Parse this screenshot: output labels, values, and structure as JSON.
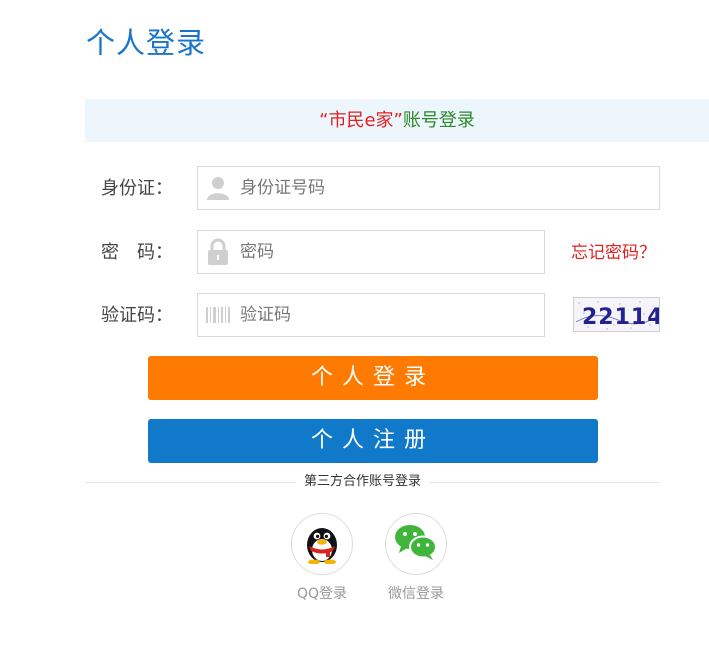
{
  "header": {
    "title": "个人登录"
  },
  "banner": {
    "brand": "“市民e家”",
    "suffix": "账号登录"
  },
  "form": {
    "id_label": "身份证：",
    "id_placeholder": "身份证号码",
    "password_label": "密　码：",
    "password_placeholder": "密码",
    "forgot_label": "忘记密码？",
    "captcha_label": "验证码：",
    "captcha_placeholder": "验证码",
    "captcha_text": "22114"
  },
  "actions": {
    "login_label": "个人登录",
    "register_label": "个人注册"
  },
  "third_party": {
    "title": "第三方合作账号登录",
    "qq_label": "QQ登录",
    "wechat_label": "微信登录"
  },
  "colors": {
    "title": "#1a74c9",
    "brand_red": "#e02020",
    "brand_green": "#2a8a2a",
    "login_button": "#ff7a00",
    "register_button": "#1179c9"
  },
  "icons": {
    "id_field": "user-icon",
    "password_field": "lock-icon",
    "captcha_field": "barcode-icon",
    "qq": "qq-penguin-icon",
    "wechat": "wechat-bubbles-icon"
  }
}
